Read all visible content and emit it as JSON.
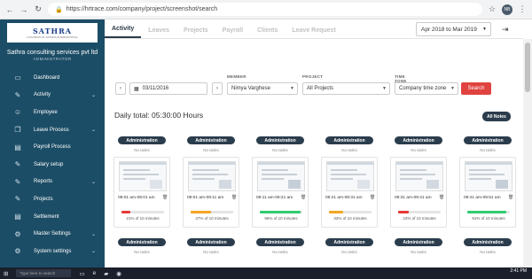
{
  "browser": {
    "url": "https://hrtrace.com/company/project/screenshot/search",
    "avatar_initials": "NB"
  },
  "sidebar": {
    "logo_text": "SATHRA",
    "logo_sub": "A DIVISION OF SATHRA INTERNATIONAL",
    "company": "Sathra consulting services pvt ltd",
    "role": "ADMINISTRATOR",
    "items": [
      {
        "label": "Dashboard",
        "icon": "dashboard-icon",
        "glyph": "▭",
        "expandable": false
      },
      {
        "label": "Activity",
        "icon": "pencil-icon",
        "glyph": "✎",
        "expandable": true
      },
      {
        "label": "Employee",
        "icon": "people-icon",
        "glyph": "☺",
        "expandable": false
      },
      {
        "label": "Leave Process",
        "icon": "layers-icon",
        "glyph": "❐",
        "expandable": true
      },
      {
        "label": "Payroll Process",
        "icon": "document-icon",
        "glyph": "▤",
        "expandable": false
      },
      {
        "label": "Salary setup",
        "icon": "salary-icon",
        "glyph": "✎",
        "expandable": false
      },
      {
        "label": "Reports",
        "icon": "reports-icon",
        "glyph": "✎",
        "expandable": true
      },
      {
        "label": "Projects",
        "icon": "projects-icon",
        "glyph": "✎",
        "expandable": false
      },
      {
        "label": "Settlement",
        "icon": "settlement-icon",
        "glyph": "▤",
        "expandable": false
      },
      {
        "label": "Master Settings",
        "icon": "gear-icon",
        "glyph": "⚙",
        "expandable": true
      },
      {
        "label": "System settings",
        "icon": "gear-icon",
        "glyph": "⚙",
        "expandable": true
      }
    ]
  },
  "tabs": [
    "Activity",
    "Leaves",
    "Projects",
    "Payroll",
    "Clients",
    "Leave Request"
  ],
  "date_range": "Apr 2018 to Mar 2019",
  "filters": {
    "date_value": "03/11/2016",
    "member_label": "MEMBER",
    "member_value": "Nimya Varghese",
    "project_label": "PROJECT",
    "project_value": "All Projects",
    "timezone_label": "TIME ZONE",
    "timezone_value": "Company time zone",
    "search_label": "Search"
  },
  "daily_total": "Daily total: 05:30:00 Hours",
  "all_notes_label": "All Notes",
  "colors": {
    "sidebar": "#1c4d66",
    "accent": "#e0433f",
    "badge": "#2b3d4d",
    "red": "#e53935",
    "yellow": "#f5a623",
    "green": "#2ecc71"
  },
  "cards": [
    {
      "badge": "Administration",
      "no_tasks": "No tasks",
      "time": "08:01 am-09:01 am",
      "percent": 0.21,
      "pct_label": "21% of 10 minutes",
      "bar": "red"
    },
    {
      "badge": "Administration",
      "no_tasks": "No tasks",
      "time": "09:01 am-09:11 am",
      "percent": 0.47,
      "pct_label": "47% of 10 minutes",
      "bar": "yellow"
    },
    {
      "badge": "Administration",
      "no_tasks": "No tasks",
      "time": "09:11 am-09:21 am",
      "percent": 0.96,
      "pct_label": "96% of 10 minutes",
      "bar": "green"
    },
    {
      "badge": "Administration",
      "no_tasks": "No tasks",
      "time": "09:21 am-09:31 am",
      "percent": 0.33,
      "pct_label": "33% of 10 minutes",
      "bar": "yellow"
    },
    {
      "badge": "Administration",
      "no_tasks": "No tasks",
      "time": "09:31 am-09:41 am",
      "percent": 0.24,
      "pct_label": "24% of 10 minutes",
      "bar": "red"
    },
    {
      "badge": "Administration",
      "no_tasks": "No tasks",
      "time": "09:41 am-09:51 am",
      "percent": 0.91,
      "pct_label": "91% of 10 minutes",
      "bar": "green"
    }
  ],
  "row2_cards": [
    {
      "badge": "Administration",
      "no_tasks": "No tasks"
    },
    {
      "badge": "Administration",
      "no_tasks": "No tasks"
    },
    {
      "badge": "Administration",
      "no_tasks": "No tasks"
    },
    {
      "badge": "Administration",
      "no_tasks": "No tasks"
    },
    {
      "badge": "Administration",
      "no_tasks": "No tasks"
    },
    {
      "badge": "Administration",
      "no_tasks": "No tasks"
    }
  ],
  "taskbar": {
    "search_placeholder": "Type here to search",
    "time": "2:41 PM"
  }
}
